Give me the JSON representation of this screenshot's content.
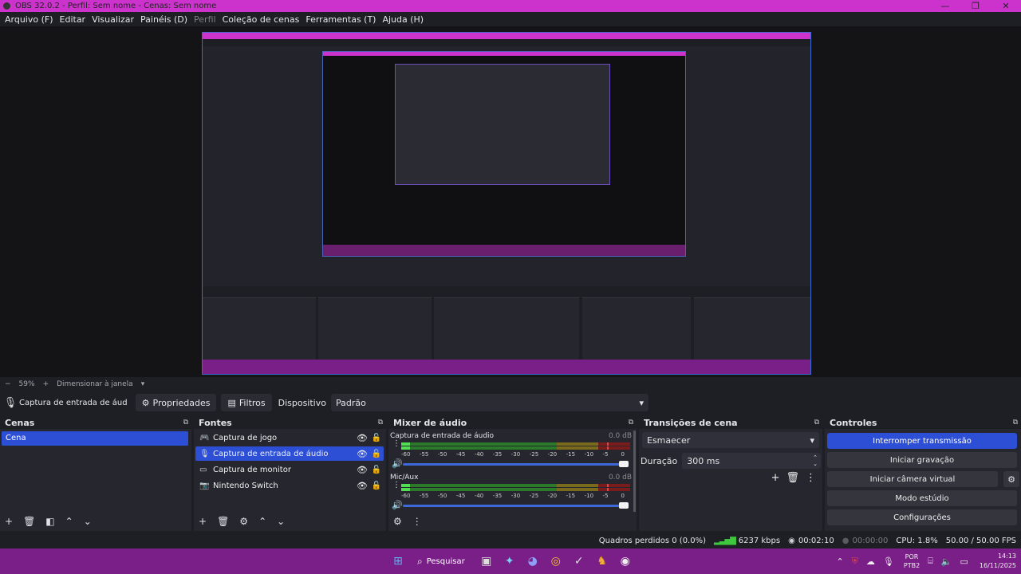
{
  "window": {
    "title": "OBS 32.0.2 - Perfil: Sem nome - Cenas: Sem nome"
  },
  "menu": [
    {
      "label": "Arquivo (F)",
      "enabled": true
    },
    {
      "label": "Editar",
      "enabled": true
    },
    {
      "label": "Visualizar",
      "enabled": true
    },
    {
      "label": "Painéis (D)",
      "enabled": true
    },
    {
      "label": "Perfil",
      "enabled": false
    },
    {
      "label": "Coleção de cenas",
      "enabled": true
    },
    {
      "label": "Ferramentas (T)",
      "enabled": true
    },
    {
      "label": "Ajuda (H)",
      "enabled": true
    }
  ],
  "zoom": {
    "minus": "−",
    "value": "59%",
    "plus": "+",
    "fit_label": "Dimensionar à janela",
    "dropdown_icon": "▾"
  },
  "source_bar": {
    "source_name": "Captura de entrada de áud",
    "properties_label": "Propriedades",
    "filters_label": "Filtros",
    "device_label": "Dispositivo",
    "device_value": "Padrão"
  },
  "scenes": {
    "title": "Cenas",
    "items": [
      "Cena"
    ]
  },
  "sources": {
    "title": "Fontes",
    "items": [
      {
        "label": "Captura de jogo",
        "icon": "gamepad-icon",
        "selected": false
      },
      {
        "label": "Captura de entrada de áudio",
        "icon": "mic-icon",
        "selected": true
      },
      {
        "label": "Captura de monitor",
        "icon": "monitor-icon",
        "selected": false
      },
      {
        "label": "Nintendo Switch",
        "icon": "camera-icon",
        "selected": false
      }
    ]
  },
  "mixer": {
    "title": "Mixer de áudio",
    "ticks": [
      "-60",
      "-55",
      "-50",
      "-45",
      "-40",
      "-35",
      "-30",
      "-25",
      "-20",
      "-15",
      "-10",
      "-5",
      "0"
    ],
    "channels": [
      {
        "name": "Captura de entrada de áudio",
        "db": "0.0 dB"
      },
      {
        "name": "Mic/Aux",
        "db": "0.0 dB"
      }
    ]
  },
  "transitions": {
    "title": "Transições de cena",
    "selected": "Esmaecer",
    "duration_label": "Duração",
    "duration_value": "300 ms"
  },
  "controls": {
    "title": "Controles",
    "stream": "Interromper transmissão",
    "record": "Iniciar gravação",
    "virtualcam": "Iniciar câmera virtual",
    "studio": "Modo estúdio",
    "settings": "Configurações"
  },
  "status": {
    "dropped": "Quadros perdidos 0 (0.0%)",
    "bitrate": "6237 kbps",
    "live_time": "00:02:10",
    "rec_time": "00:00:00",
    "cpu": "CPU: 1.8%",
    "fps": "50.00 / 50.00 FPS"
  },
  "taskbar": {
    "search_label": "Pesquisar",
    "lang_top": "POR",
    "lang_bottom": "PTB2",
    "time": "14:13",
    "date": "16/11/2025"
  },
  "colors": {
    "title_bar": "#cc33cc",
    "accent": "#2d4fd6",
    "taskbar": "#7a1f88",
    "meter_green": "#4ee04e",
    "meter_peak": "#e04646"
  }
}
